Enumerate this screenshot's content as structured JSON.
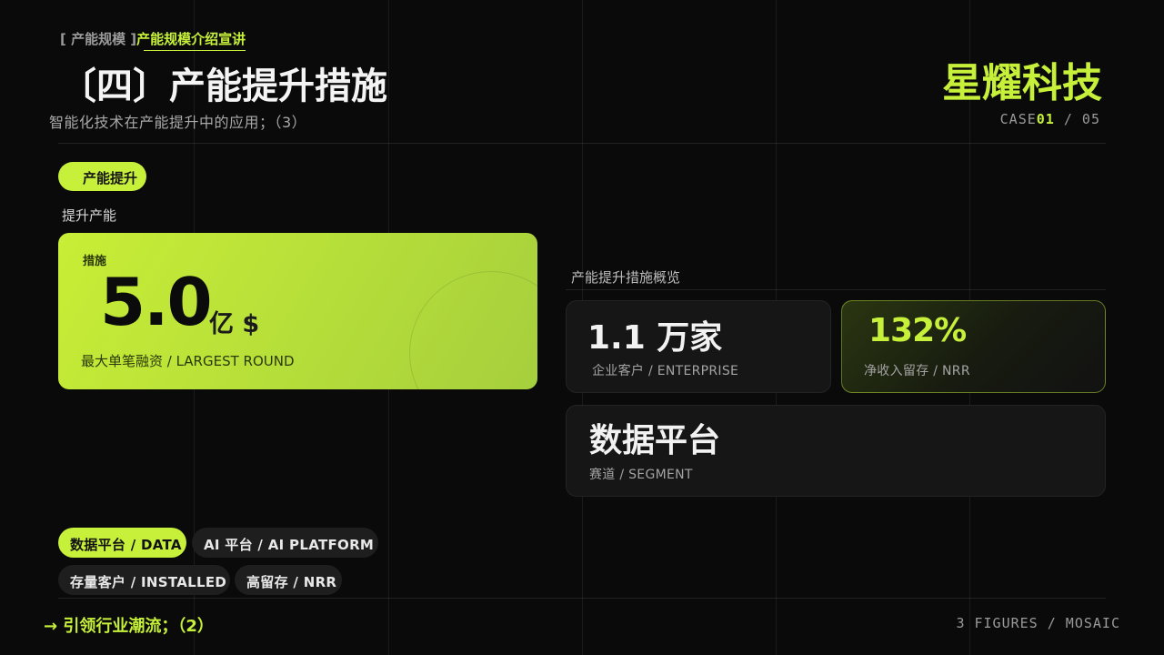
{
  "header": {
    "crumb_prefix": "[ 产能规模 ]",
    "crumb_highlight": "产能规模介绍宣讲",
    "title": "〔四〕产能提升措施",
    "subtitle": "智能化技术在产能提升中的应用；（3）",
    "brand": "星耀科技",
    "case_label": "CASE",
    "case_current": "01",
    "case_total": "/ 05"
  },
  "section": {
    "pill": "产能提升",
    "label": "提升产能"
  },
  "hero": {
    "label": "措施",
    "value": "5.0",
    "unit": "亿 $",
    "caption": "最大单笔融资 / LARGEST ROUND"
  },
  "overview": {
    "title": "产能提升措施概览",
    "cards": [
      {
        "value": "1.1  万家",
        "caption": "企业客户 / ENTERPRISE"
      },
      {
        "value": "132%",
        "caption": "净收入留存 / NRR"
      },
      {
        "value": "数据平台",
        "caption": "赛道 / SEGMENT"
      }
    ]
  },
  "chips": [
    {
      "label": "数据平台 / DATA",
      "active": true
    },
    {
      "label": "AI 平台 / AI PLATFORM",
      "active": false
    },
    {
      "label": "存量客户 / INSTALLED",
      "active": false
    },
    {
      "label": "高留存 / NRR",
      "active": false
    }
  ],
  "footer": {
    "left": "→ 引领行业潮流；（2）",
    "right": "3 FIGURES / MOSAIC"
  },
  "colors": {
    "accent": "#c6f03a",
    "background": "#0a0a0a",
    "card": "#161616"
  }
}
